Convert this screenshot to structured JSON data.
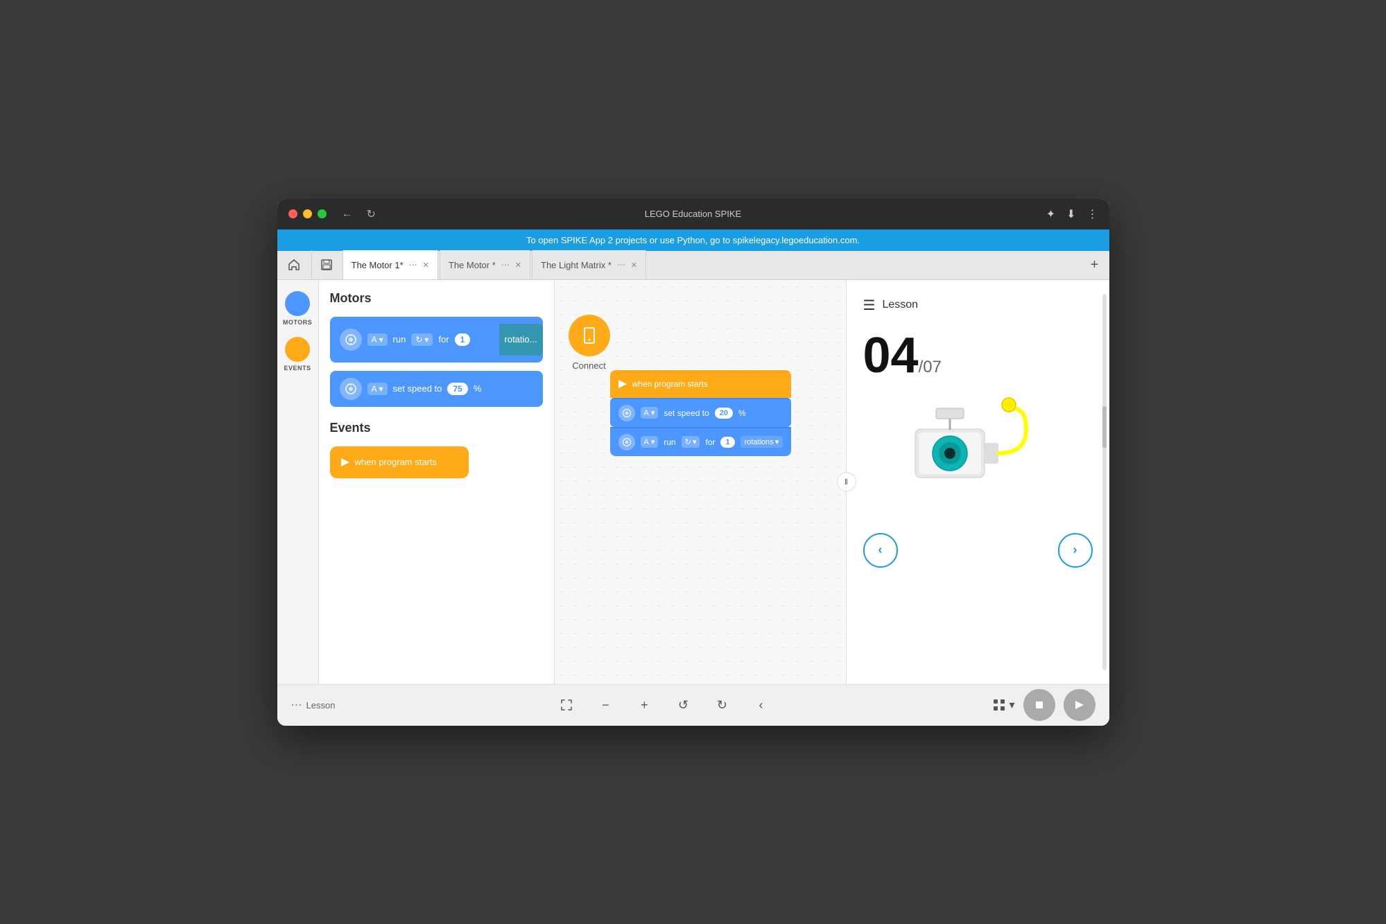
{
  "window": {
    "title": "LEGO Education SPIKE"
  },
  "banner": {
    "text": "To open SPIKE App 2 projects or use Python, go to spikelegacy.legoeducation.com."
  },
  "tabs": [
    {
      "label": "The Motor 1*",
      "active": true
    },
    {
      "label": "The Motor *",
      "active": false
    },
    {
      "label": "The Light Matrix *",
      "active": false
    }
  ],
  "sidebar": {
    "items": [
      {
        "label": "MOTORS",
        "color": "#4c97ff"
      },
      {
        "label": "EVENTS",
        "color": "#ffab19"
      }
    ]
  },
  "blocks_panel": {
    "motors_title": "Motors",
    "events_title": "Events",
    "motor_block_1": {
      "port": "A",
      "action": "run",
      "value": "1",
      "suffix": "rotatio..."
    },
    "motor_block_2": {
      "port": "A",
      "action": "set speed to",
      "value": "75",
      "unit": "%"
    },
    "event_block": {
      "label": "when program starts"
    }
  },
  "connect": {
    "label": "Connect"
  },
  "workspace": {
    "when_start_label": "when program starts",
    "set_speed_label": "set speed to",
    "run_label": "run",
    "port_a": "A",
    "speed_value": "20",
    "speed_unit": "%",
    "rotations_label": "rotations",
    "run_value": "1"
  },
  "lesson": {
    "header": "Lesson",
    "number": "04",
    "total": "/07",
    "nav_prev": "‹",
    "nav_next": "›"
  },
  "toolbar": {
    "lesson_label": "Lesson",
    "fit_icon": "fit",
    "zoom_out": "−",
    "zoom_in": "+",
    "undo": "↺",
    "redo": "↻",
    "arrow": "‹"
  }
}
